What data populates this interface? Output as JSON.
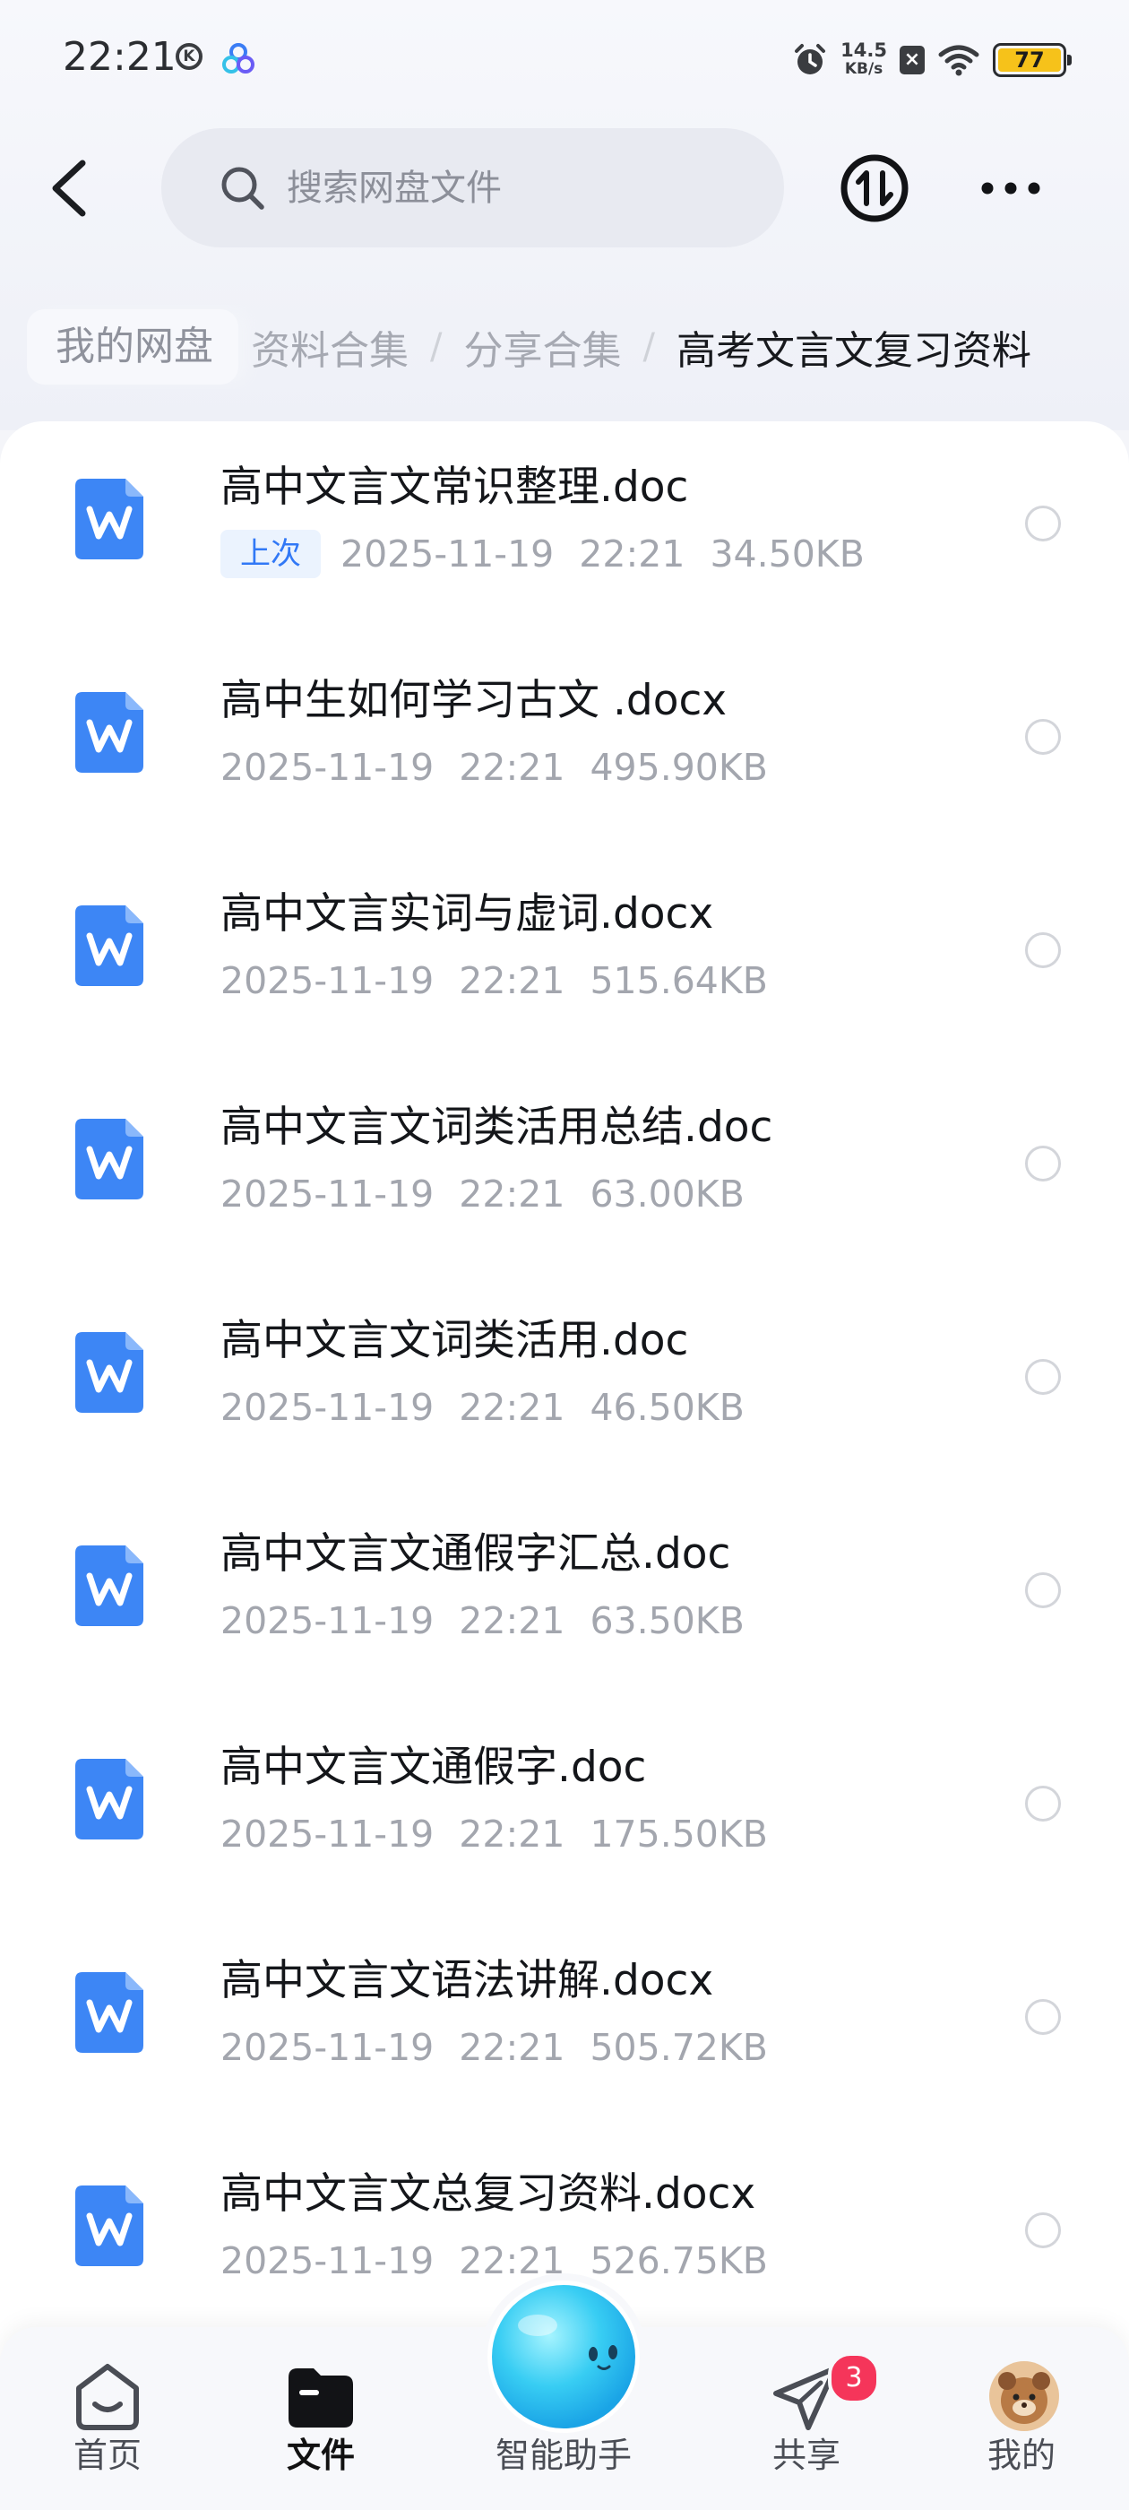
{
  "status_bar": {
    "time": "22:21",
    "k_badge": "K",
    "net_speed_value": "14.5",
    "net_speed_unit": "KB/s",
    "battery_level": "77",
    "icons": [
      "k-circle-icon",
      "app-notification-icon",
      "alarm-icon",
      "sim-disabled-icon",
      "wifi-icon",
      "battery-icon"
    ]
  },
  "header": {
    "back_icon": "chevron-left-icon",
    "search_placeholder": "搜索网盘文件",
    "search_icon": "search-icon",
    "transfer_icon": "transfer-icon",
    "more_icon": "more-icon"
  },
  "breadcrumb": {
    "home": "我的网盘",
    "items": [
      "资料合集",
      "分享合集"
    ],
    "separator": "/",
    "current": "高考文言文复习资料"
  },
  "files": [
    {
      "name": "高中文言文常识整理.doc",
      "badge": "上次",
      "date": "2025-11-19",
      "time": "22:21",
      "size": "34.50KB"
    },
    {
      "name": "高中生如何学习古文 .docx",
      "date": "2025-11-19",
      "time": "22:21",
      "size": "495.90KB"
    },
    {
      "name": "高中文言实词与虚词.docx",
      "date": "2025-11-19",
      "time": "22:21",
      "size": "515.64KB"
    },
    {
      "name": "高中文言文词类活用总结.doc",
      "date": "2025-11-19",
      "time": "22:21",
      "size": "63.00KB"
    },
    {
      "name": "高中文言文词类活用.doc",
      "date": "2025-11-19",
      "time": "22:21",
      "size": "46.50KB"
    },
    {
      "name": "高中文言文通假字汇总.doc",
      "date": "2025-11-19",
      "time": "22:21",
      "size": "63.50KB"
    },
    {
      "name": "高中文言文通假字.doc",
      "date": "2025-11-19",
      "time": "22:21",
      "size": "175.50KB"
    },
    {
      "name": "高中文言文语法讲解.docx",
      "date": "2025-11-19",
      "time": "22:21",
      "size": "505.72KB"
    },
    {
      "name": "高中文言文总复习资料.docx",
      "date": "2025-11-19",
      "time": "22:21",
      "size": "526.75KB"
    }
  ],
  "bottom_nav": {
    "items": [
      {
        "label": "首页",
        "icon": "home-icon"
      },
      {
        "label": "文件",
        "icon": "folder-icon",
        "active": true
      },
      {
        "label": "智能助手",
        "icon": "assistant-orb-icon"
      },
      {
        "label": "共享",
        "icon": "paper-plane-icon",
        "badge": "3"
      },
      {
        "label": "我的",
        "icon": "avatar"
      }
    ]
  },
  "colors": {
    "accent": "#3178f6",
    "doc_icon": "#3d86f5",
    "badge_bg": "#ebf3fe",
    "notification_badge": "#f5355a",
    "battery": "#f6c21a"
  }
}
